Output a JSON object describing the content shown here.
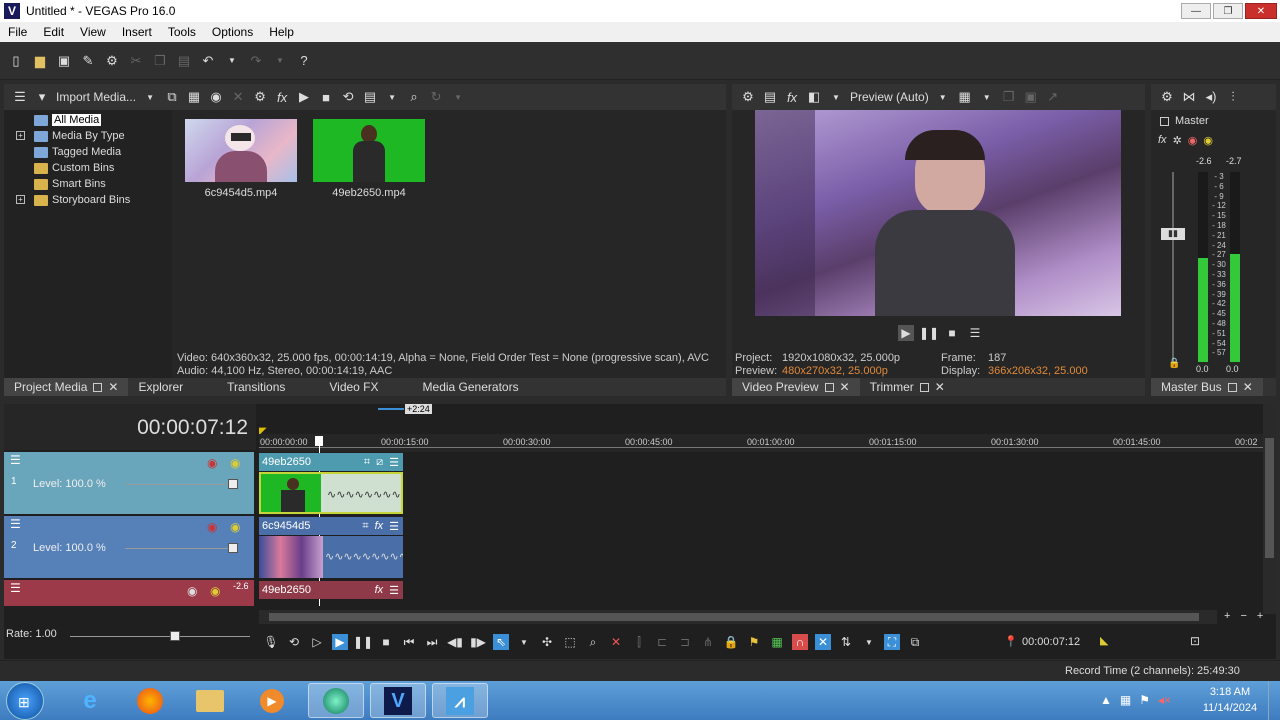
{
  "window": {
    "title": "Untitled * - VEGAS Pro 16.0",
    "minimize": "—",
    "maximize": "❐",
    "close": "✕"
  },
  "menu": [
    "File",
    "Edit",
    "View",
    "Insert",
    "Tools",
    "Options",
    "Help"
  ],
  "project_media": {
    "toolbar_label": "Import Media...",
    "tree": [
      {
        "label": "All Media",
        "expand": false,
        "selected": true
      },
      {
        "label": "Media By Type",
        "expand": true
      },
      {
        "label": "Tagged Media",
        "expand": false
      },
      {
        "label": "Custom Bins",
        "expand": false
      },
      {
        "label": "Smart Bins",
        "expand": false
      },
      {
        "label": "Storyboard Bins",
        "expand": true
      }
    ],
    "files": [
      {
        "name": "6c9454d5.mp4"
      },
      {
        "name": "49eb2650.mp4"
      }
    ],
    "info_line1": "Video: 640x360x32, 25.000 fps, 00:00:14:19, Alpha = None, Field Order Test = None (progressive scan), AVC",
    "info_line2": "Audio: 44,100 Hz, Stereo, 00:00:14:19, AAC",
    "tabs": [
      "Project Media",
      "Explorer",
      "Transitions",
      "Video FX",
      "Media Generators"
    ]
  },
  "preview": {
    "mode_label": "Preview (Auto)",
    "project_label": "Project:",
    "project_value": "1920x1080x32, 25.000p",
    "preview_label": "Preview:",
    "preview_value": "480x270x32, 25.000p",
    "frame_label": "Frame:",
    "frame_value": "187",
    "display_label": "Display:",
    "display_value": "366x206x32, 25.000",
    "tabs": [
      "Video Preview",
      "Trimmer"
    ]
  },
  "master": {
    "label": "Master",
    "peak_left": "-2.6",
    "peak_right": "-2.7",
    "scale": [
      "3",
      "6",
      "9",
      "12",
      "15",
      "18",
      "21",
      "24",
      "27",
      "30",
      "33",
      "36",
      "39",
      "42",
      "45",
      "48",
      "51",
      "54",
      "57"
    ],
    "bottom_left": "0.0",
    "bottom_right": "0.0",
    "tab": "Master Bus",
    "level_left": 0.55,
    "level_right": 0.57
  },
  "timeline": {
    "timecode": "00:00:07:12",
    "offset_badge": "+2:24",
    "ruler": [
      "00:00:00:00",
      "00:00:15:00",
      "00:00:30:00",
      "00:00:45:00",
      "00:01:00:00",
      "00:01:15:00",
      "00:01:30:00",
      "00:01:45:00",
      "00:02"
    ],
    "tracks": [
      {
        "num": "1",
        "level": "Level: 100.0 %",
        "clip": "49eb2650"
      },
      {
        "num": "2",
        "level": "Level: 100.0 %",
        "clip": "6c9454d5"
      },
      {
        "num": "",
        "level": "",
        "clip": "49eb2650",
        "peak": "-2.6"
      }
    ],
    "rate": "Rate: 1.00",
    "cursor_time": "00:00:07:12",
    "record_time": "Record Time (2 channels): 25:49:30"
  },
  "taskbar": {
    "time": "3:18 AM",
    "date": "11/14/2024"
  }
}
